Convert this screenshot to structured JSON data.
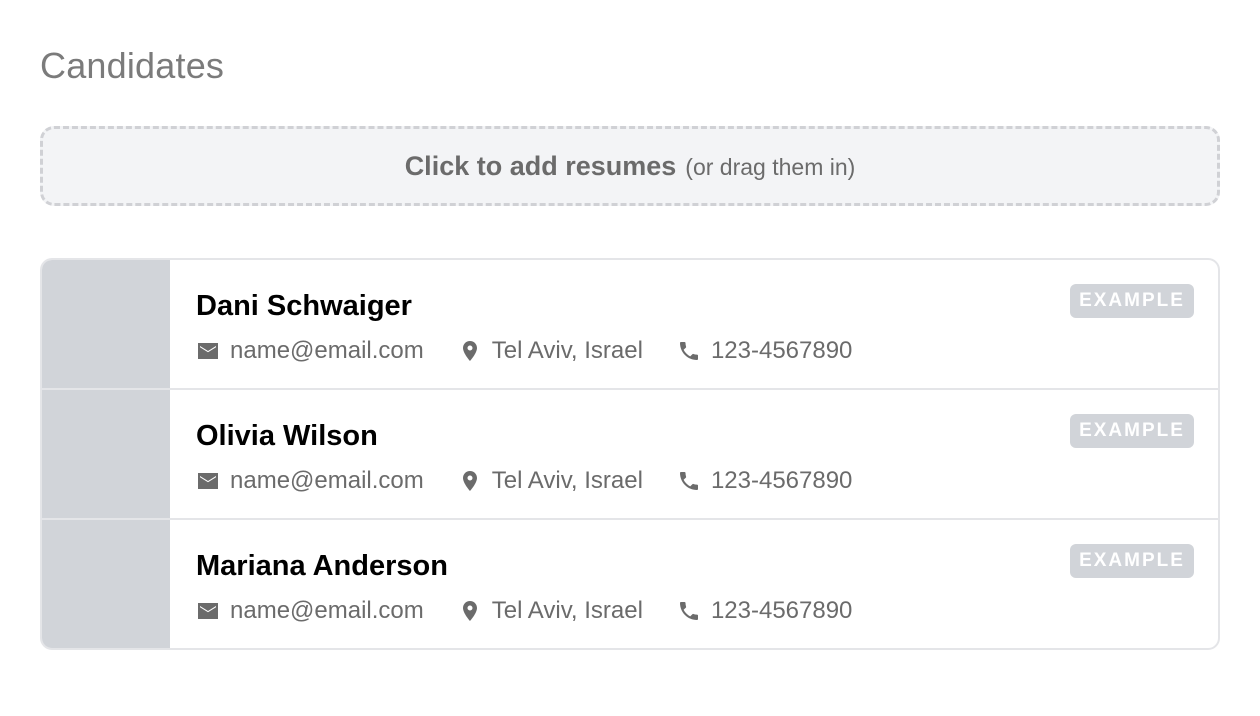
{
  "page": {
    "title": "Candidates"
  },
  "dropzone": {
    "label": "Click to add resumes",
    "hint": "(or drag them in)"
  },
  "colors": {
    "title": "#7b7b7b",
    "dropzone_bg": "#f3f4f6",
    "dropzone_border": "#d0d1d5",
    "avatar_placeholder": "#d1d4d9",
    "badge_bg": "#d1d4d9",
    "meta_text": "#6b6b6b"
  },
  "icons": {
    "email": "email-icon",
    "location": "map-pin-icon",
    "phone": "phone-icon"
  },
  "candidates": [
    {
      "name": "Dani Schwaiger",
      "email": "name@email.com",
      "location": "Tel Aviv, Israel",
      "phone": "123-4567890",
      "badge": "EXAMPLE"
    },
    {
      "name": "Olivia Wilson",
      "email": "name@email.com",
      "location": "Tel Aviv, Israel",
      "phone": "123-4567890",
      "badge": "EXAMPLE"
    },
    {
      "name": "Mariana Anderson",
      "email": "name@email.com",
      "location": "Tel Aviv, Israel",
      "phone": "123-4567890",
      "badge": "EXAMPLE"
    }
  ]
}
